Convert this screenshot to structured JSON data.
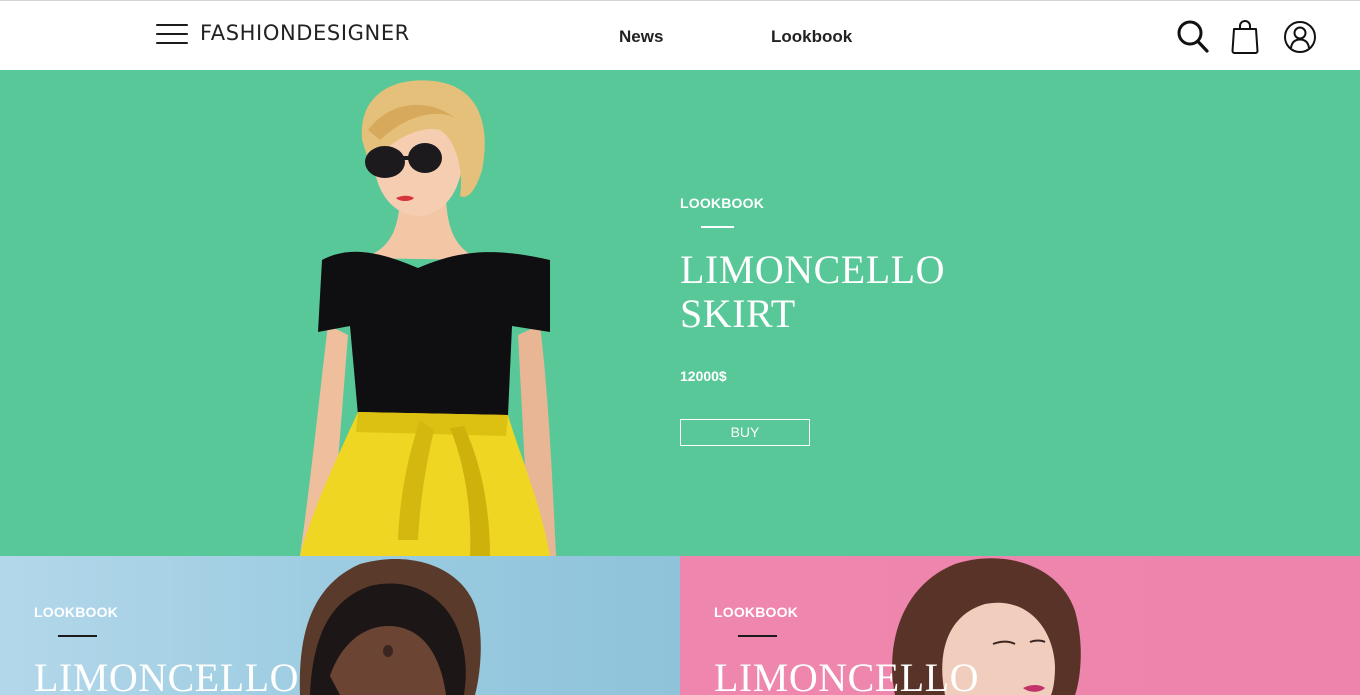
{
  "header": {
    "logo": "FASHIONDESIGNER",
    "nav": [
      "News",
      "Lookbook"
    ],
    "icons": [
      "menu-icon",
      "search-icon",
      "shopping-bag-icon",
      "user-icon"
    ]
  },
  "hero": {
    "kicker": "LOOKBOOK",
    "title_line1": "LIMONCELLO",
    "title_line2": "SKIRT",
    "price": "12000$",
    "buy_label": "BUY",
    "background": "#58c898"
  },
  "tiles": [
    {
      "kicker": "LOOKBOOK",
      "title": "LIMONCELLO",
      "background": "#9ccce1"
    },
    {
      "kicker": "LOOKBOOK",
      "title": "LIMONCELLO",
      "background": "#ee86ad"
    }
  ],
  "colors": {
    "accent_green": "#58c898",
    "accent_blue": "#9ccce1",
    "accent_pink": "#ee86ad",
    "text_dark": "#222222"
  }
}
